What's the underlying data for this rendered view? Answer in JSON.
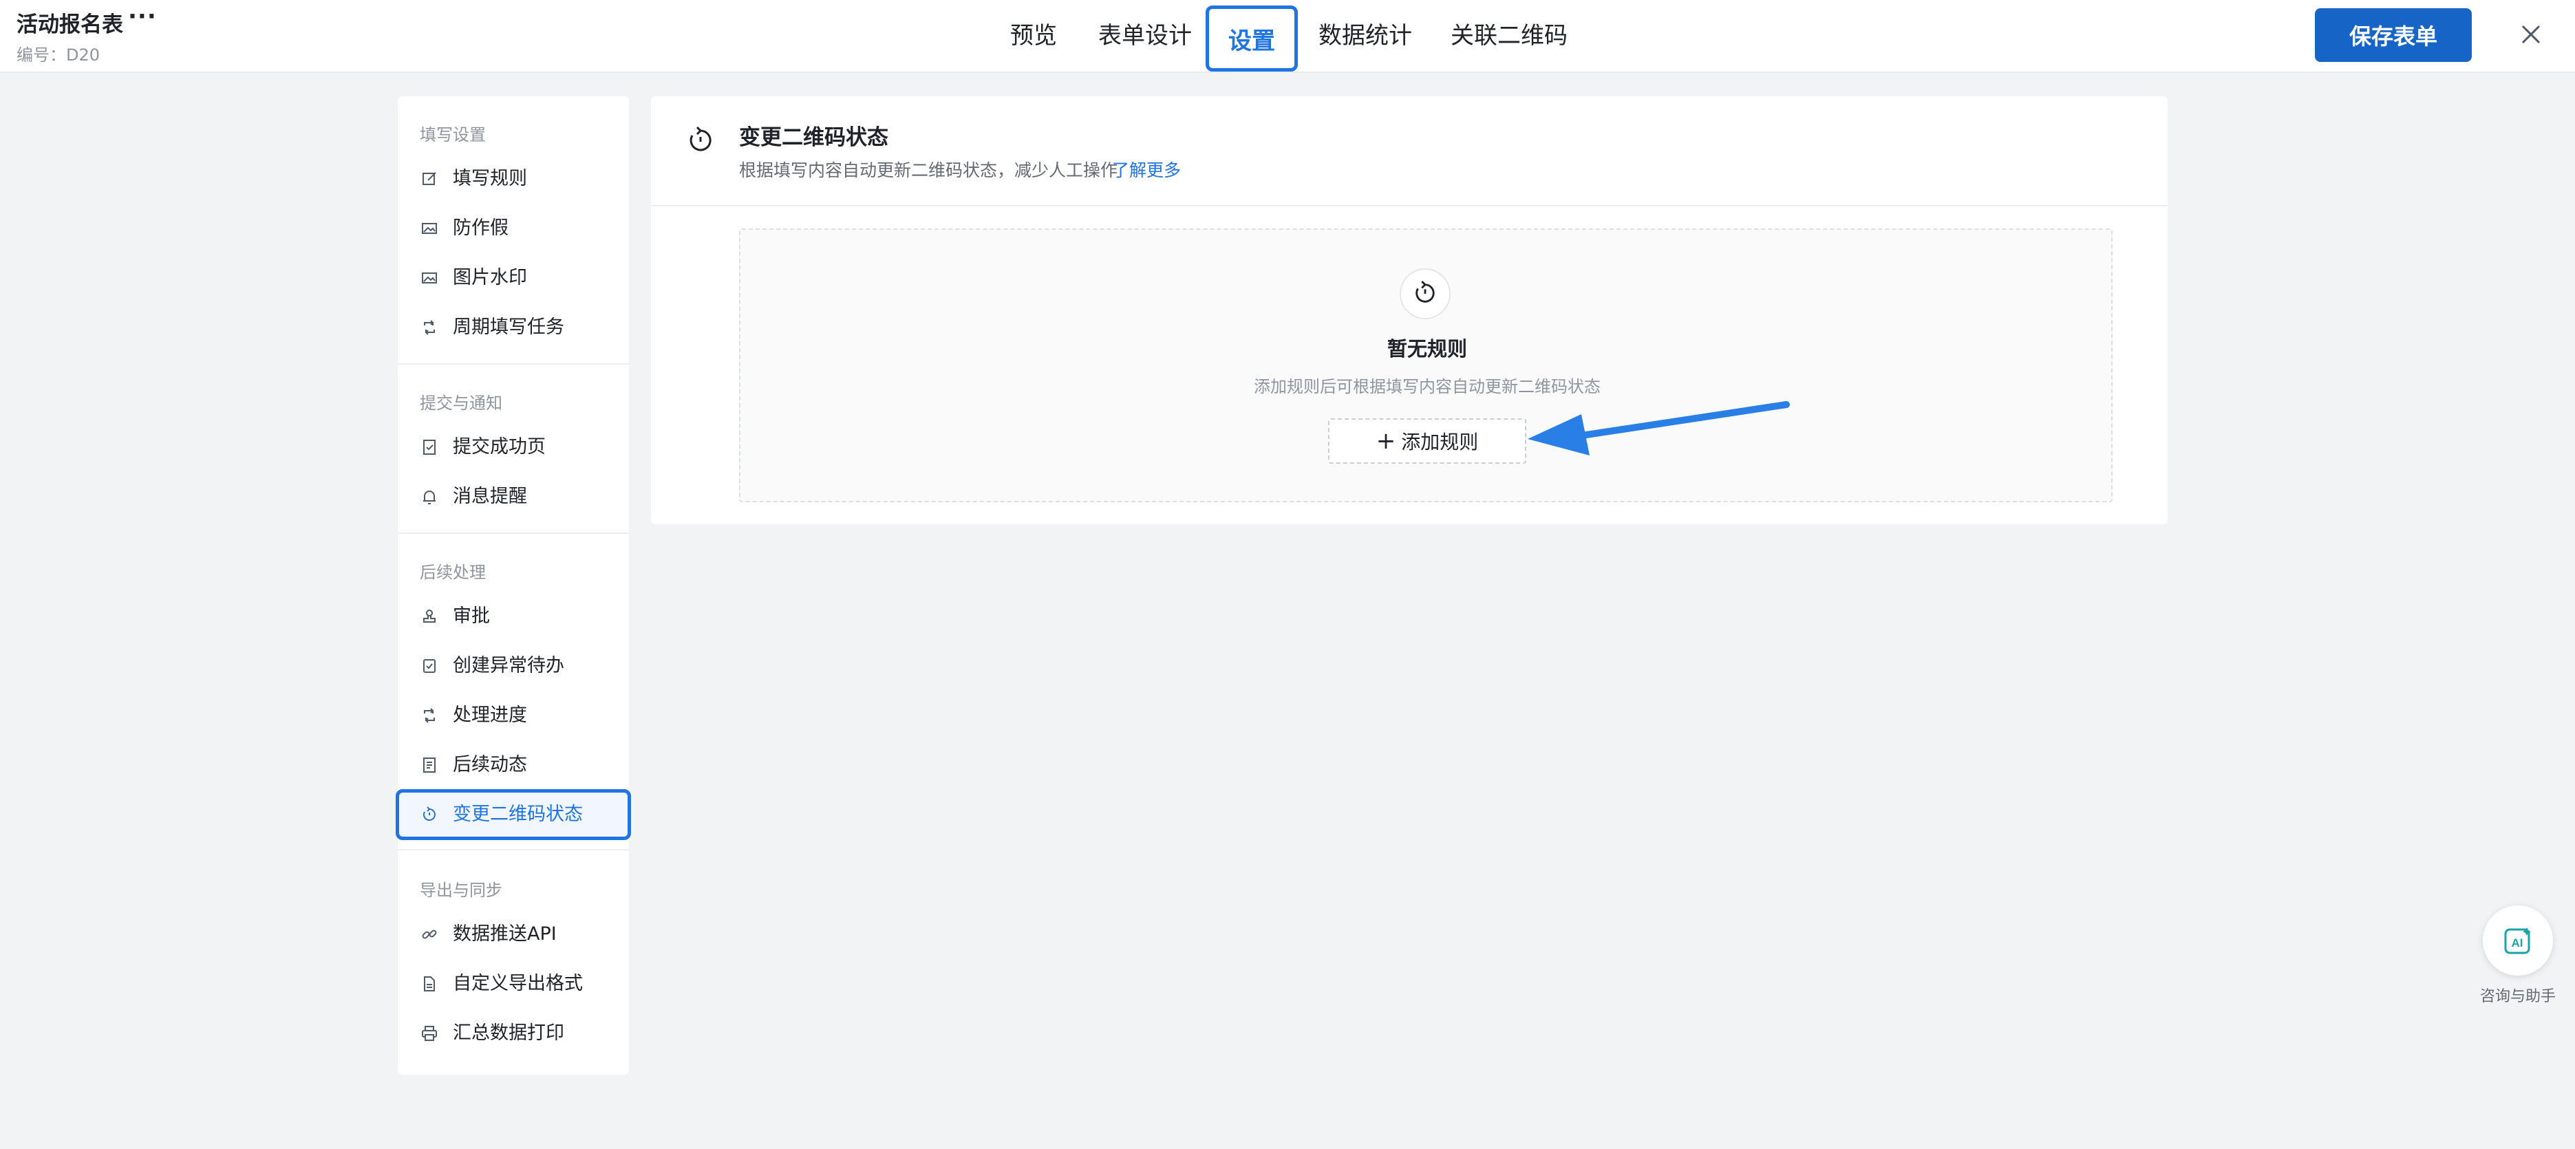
{
  "header": {
    "title": "活动报名表",
    "more": "···",
    "form_id": "编号：D20",
    "save_label": "保存表单"
  },
  "tabs": [
    {
      "label": "预览"
    },
    {
      "label": "表单设计"
    },
    {
      "label": "设置",
      "active": true
    },
    {
      "label": "数据统计"
    },
    {
      "label": "关联二维码"
    }
  ],
  "sidebar": {
    "groups": [
      {
        "title": "填写设置",
        "items": [
          {
            "label": "填写规则",
            "icon": "edit-icon"
          },
          {
            "label": "防作假",
            "icon": "image-icon"
          },
          {
            "label": "图片水印",
            "icon": "image-icon"
          },
          {
            "label": "周期填写任务",
            "icon": "repeat-icon"
          }
        ]
      },
      {
        "title": "提交与通知",
        "items": [
          {
            "label": "提交成功页",
            "icon": "doc-check-icon"
          },
          {
            "label": "消息提醒",
            "icon": "bell-icon"
          }
        ]
      },
      {
        "title": "后续处理",
        "items": [
          {
            "label": "审批",
            "icon": "stamp-icon"
          },
          {
            "label": "创建异常待办",
            "icon": "task-icon"
          },
          {
            "label": "处理进度",
            "icon": "repeat-icon"
          },
          {
            "label": "后续动态",
            "icon": "list-doc-icon"
          },
          {
            "label": "变更二维码状态",
            "icon": "refresh-timer-icon",
            "active": true
          }
        ]
      },
      {
        "title": "导出与同步",
        "items": [
          {
            "label": "数据推送API",
            "icon": "link-icon"
          },
          {
            "label": "自定义导出格式",
            "icon": "file-icon"
          },
          {
            "label": "汇总数据打印",
            "icon": "printer-icon"
          }
        ]
      }
    ]
  },
  "main": {
    "title": "变更二维码状态",
    "description": "根据填写内容自动更新二维码状态，减少人工操作",
    "link": "了解更多",
    "empty_title": "暂无规则",
    "empty_desc": "添加规则后可根据填写内容自动更新二维码状态",
    "add_label": "添加规则",
    "add_plus": "+"
  },
  "assistant": {
    "label": "咨询与助手",
    "icon_text": "AI"
  },
  "colors": {
    "accent": "#1f74e0",
    "primary_button": "#1564c6",
    "annotation_arrow": "#2a7fe6",
    "assistant_icon": "#1aa3a8"
  }
}
